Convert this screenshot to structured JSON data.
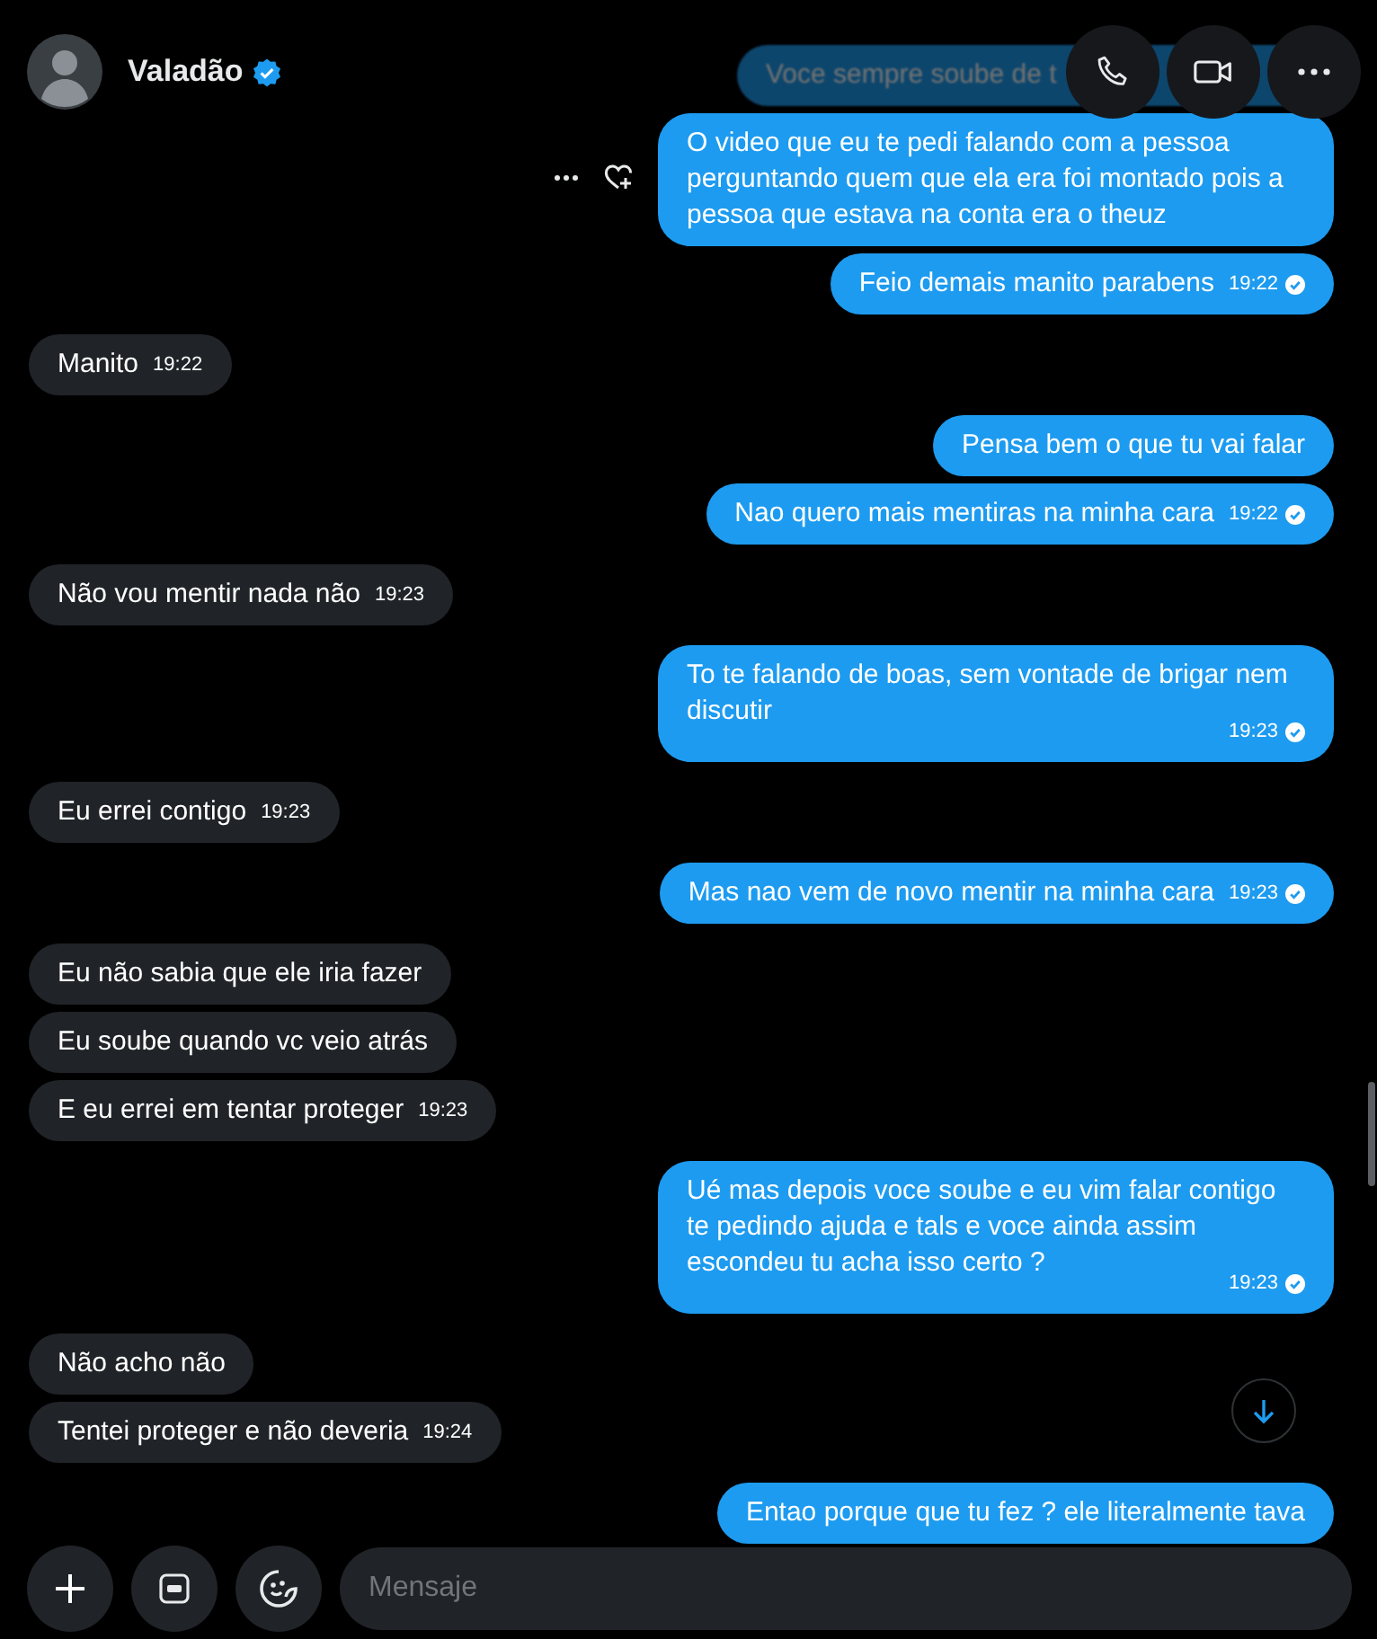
{
  "header": {
    "name": "Valadão",
    "verified": true
  },
  "groups": [
    {
      "kind": "outgoing",
      "messages": [
        {
          "text": "Voce sempre soube de t",
          "kind": "faded"
        },
        {
          "text": "O video que eu te pedi falando com a pessoa perguntando quem que ela era foi montado pois a pessoa que estava na conta era o theuz",
          "kind": "hover"
        },
        {
          "text": "Feio demais manito parabens",
          "time": "19:22",
          "read": true,
          "kind": "plain"
        }
      ]
    },
    {
      "kind": "incoming",
      "messages": [
        {
          "text": "Manito",
          "time": "19:22",
          "kind": "plain"
        }
      ]
    },
    {
      "kind": "outgoing",
      "messages": [
        {
          "text": "Pensa bem o que tu vai falar",
          "kind": "plain"
        },
        {
          "text": "Nao quero mais mentiras na minha cara",
          "time": "19:22",
          "read": true,
          "kind": "plain"
        }
      ]
    },
    {
      "kind": "incoming",
      "messages": [
        {
          "text": "Não vou mentir nada não",
          "time": "19:23",
          "kind": "plain"
        }
      ]
    },
    {
      "kind": "outgoing",
      "messages": [
        {
          "text": "To te falando de boas, sem vontade de brigar nem discutir",
          "time": "19:23",
          "read": true,
          "kind": "plain"
        }
      ]
    },
    {
      "kind": "incoming",
      "messages": [
        {
          "text": "Eu errei contigo",
          "time": "19:23",
          "kind": "plain"
        }
      ]
    },
    {
      "kind": "outgoing",
      "messages": [
        {
          "text": "Mas nao vem de novo mentir na minha cara",
          "time": "19:23",
          "read": true,
          "kind": "plain"
        }
      ]
    },
    {
      "kind": "incoming",
      "messages": [
        {
          "text": "Eu não sabia que ele iria fazer",
          "kind": "plain"
        },
        {
          "text": "Eu soube quando vc veio atrás",
          "kind": "plain"
        },
        {
          "text": "E eu errei em tentar proteger",
          "time": "19:23",
          "kind": "plain"
        }
      ]
    },
    {
      "kind": "outgoing",
      "messages": [
        {
          "text": "Ué mas depois voce soube e eu vim falar contigo te pedindo ajuda e tals e voce ainda assim escondeu tu acha isso certo ?",
          "time": "19:23",
          "read": true,
          "kind": "plain"
        }
      ]
    },
    {
      "kind": "incoming",
      "messages": [
        {
          "text": "Não acho não",
          "kind": "plain"
        },
        {
          "text": "Tentei proteger e não deveria",
          "time": "19:24",
          "kind": "plain"
        }
      ]
    },
    {
      "kind": "outgoing",
      "messages": [
        {
          "text": "Entao porque que tu fez ? ele literalmente tava",
          "kind": "plain"
        }
      ]
    }
  ],
  "composer": {
    "placeholder": "Mensaje"
  }
}
